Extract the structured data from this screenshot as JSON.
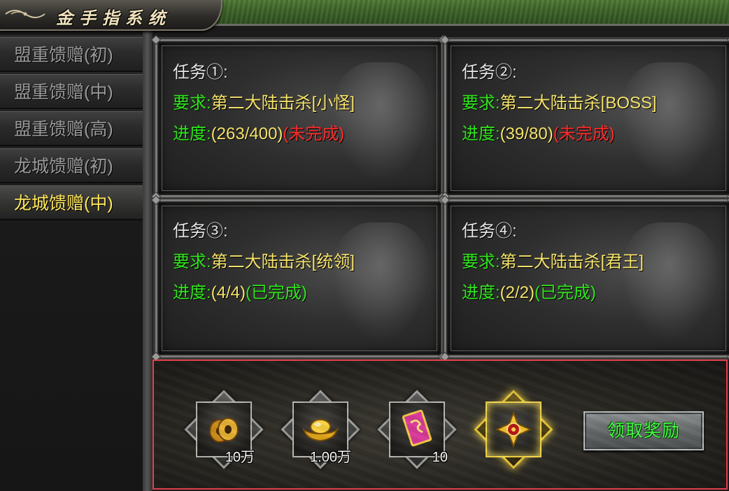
{
  "window": {
    "title": "金手指系统"
  },
  "sidebar": {
    "items": [
      {
        "label": "盟重馈赠(初)",
        "active": false
      },
      {
        "label": "盟重馈赠(中)",
        "active": false
      },
      {
        "label": "盟重馈赠(高)",
        "active": false
      },
      {
        "label": "龙城馈赠(初)",
        "active": false
      },
      {
        "label": "龙城馈赠(中)",
        "active": true
      }
    ]
  },
  "labels": {
    "requirement": "要求:",
    "progress": "进度:"
  },
  "tasks": [
    {
      "title": "任务①:",
      "requirement": "第二大陆击杀[小怪]",
      "progress": "(263/400)",
      "status": "(未完成)",
      "status_color": "#ff2b2b"
    },
    {
      "title": "任务②:",
      "requirement": "第二大陆击杀[BOSS]",
      "progress": "(39/80)",
      "status": "(未完成)",
      "status_color": "#ff2b2b"
    },
    {
      "title": "任务③:",
      "requirement": "第二大陆击杀[统领]",
      "progress": "(4/4)",
      "status": "(已完成)",
      "status_color": "#2fe51c"
    },
    {
      "title": "任务④:",
      "requirement": "第二大陆击杀[君王]",
      "progress": "(2/2)",
      "status": "(已完成)",
      "status_color": "#2fe51c"
    }
  ],
  "rewards": [
    {
      "icon": "copper-coin-icon",
      "quantity": "10万"
    },
    {
      "icon": "gold-ingot-icon",
      "quantity": "1.00万"
    },
    {
      "icon": "scroll-card-icon",
      "quantity": "10"
    },
    {
      "icon": "golden-emblem-icon",
      "quantity": ""
    }
  ],
  "claim_button": {
    "label": "领取奖励"
  },
  "colors": {
    "active_tab": "#ffe65a",
    "label_green": "#2fe51c",
    "value_yellow": "#f6e36a",
    "incomplete_red": "#ff2b2b",
    "reward_border": "#e0404c"
  }
}
